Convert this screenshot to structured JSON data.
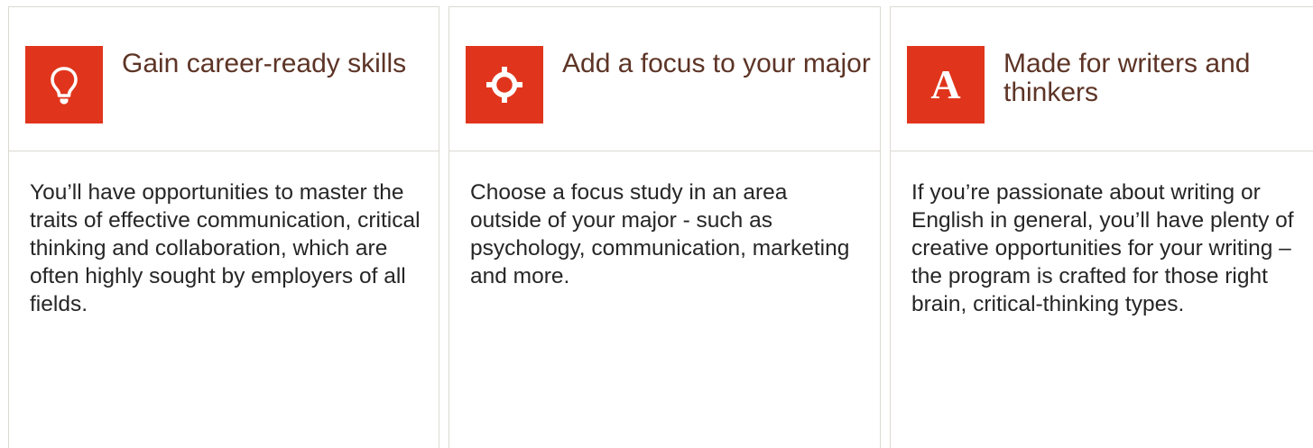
{
  "cards": [
    {
      "icon": "lightbulb-icon",
      "title": "Gain career-ready skills",
      "body": "You’ll have opportunities to master the traits of effective communication, critical thinking and collaboration, which are often highly sought by employers of all fields."
    },
    {
      "icon": "target-crosshair-icon",
      "title": "Add a focus to your major",
      "body": "Choose a focus study in an area outside of your major - such as psychology, communication, marketing and more."
    },
    {
      "icon": "serif-letter-a-icon",
      "icon_glyph": "A",
      "title": "Made for writers and thinkers",
      "body": "If you’re passionate about writing or English in general, you’ll have plenty of creative opportunities for your writing – the program is crafted for those right brain, critical-thinking types."
    }
  ],
  "colors": {
    "accent": "#e0351c",
    "title": "#5d3426",
    "body": "#262626",
    "border": "#dcd9d2"
  }
}
